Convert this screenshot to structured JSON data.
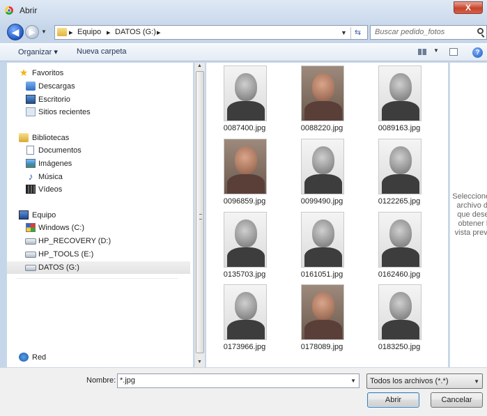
{
  "window": {
    "title": "Abrir",
    "close_label": "X"
  },
  "address": {
    "crumbs": [
      "Equipo",
      "DATOS (G:)"
    ],
    "search_placeholder": "Buscar pedido_fotos"
  },
  "toolbar": {
    "organize": "Organizar ▾",
    "new_folder": "Nueva carpeta"
  },
  "nav": {
    "favorites": {
      "label": "Favoritos",
      "items": [
        "Descargas",
        "Escritorio",
        "Sitios recientes"
      ]
    },
    "libraries": {
      "label": "Bibliotecas",
      "items": [
        "Documentos",
        "Imágenes",
        "Música",
        "Vídeos"
      ]
    },
    "computer": {
      "label": "Equipo",
      "items": [
        "Windows (C:)",
        "HP_RECOVERY (D:)",
        "HP_TOOLS (E:)",
        "DATOS (G:)"
      ],
      "selected": "DATOS (G:)"
    },
    "network": {
      "label": "Red"
    }
  },
  "files": [
    {
      "name": "0087400.jpg",
      "tone": "gray"
    },
    {
      "name": "0088220.jpg",
      "tone": "color"
    },
    {
      "name": "0089163.jpg",
      "tone": "gray"
    },
    {
      "name": "0096859.jpg",
      "tone": "color"
    },
    {
      "name": "0099490.jpg",
      "tone": "gray"
    },
    {
      "name": "0122265.jpg",
      "tone": "gray"
    },
    {
      "name": "0135703.jpg",
      "tone": "gray"
    },
    {
      "name": "0161051.jpg",
      "tone": "gray"
    },
    {
      "name": "0162460.jpg",
      "tone": "gray"
    },
    {
      "name": "0173966.jpg",
      "tone": "gray"
    },
    {
      "name": "0178089.jpg",
      "tone": "color"
    },
    {
      "name": "0183250.jpg",
      "tone": "gray"
    }
  ],
  "preview": {
    "message": "Seleccione el archivo del que desea obtener la vista previa."
  },
  "bottom": {
    "name_label": "Nombre:",
    "name_value": "*.jpg",
    "filter_value": "Todos los archivos (*.*)",
    "open_label": "Abrir",
    "cancel_label": "Cancelar"
  }
}
